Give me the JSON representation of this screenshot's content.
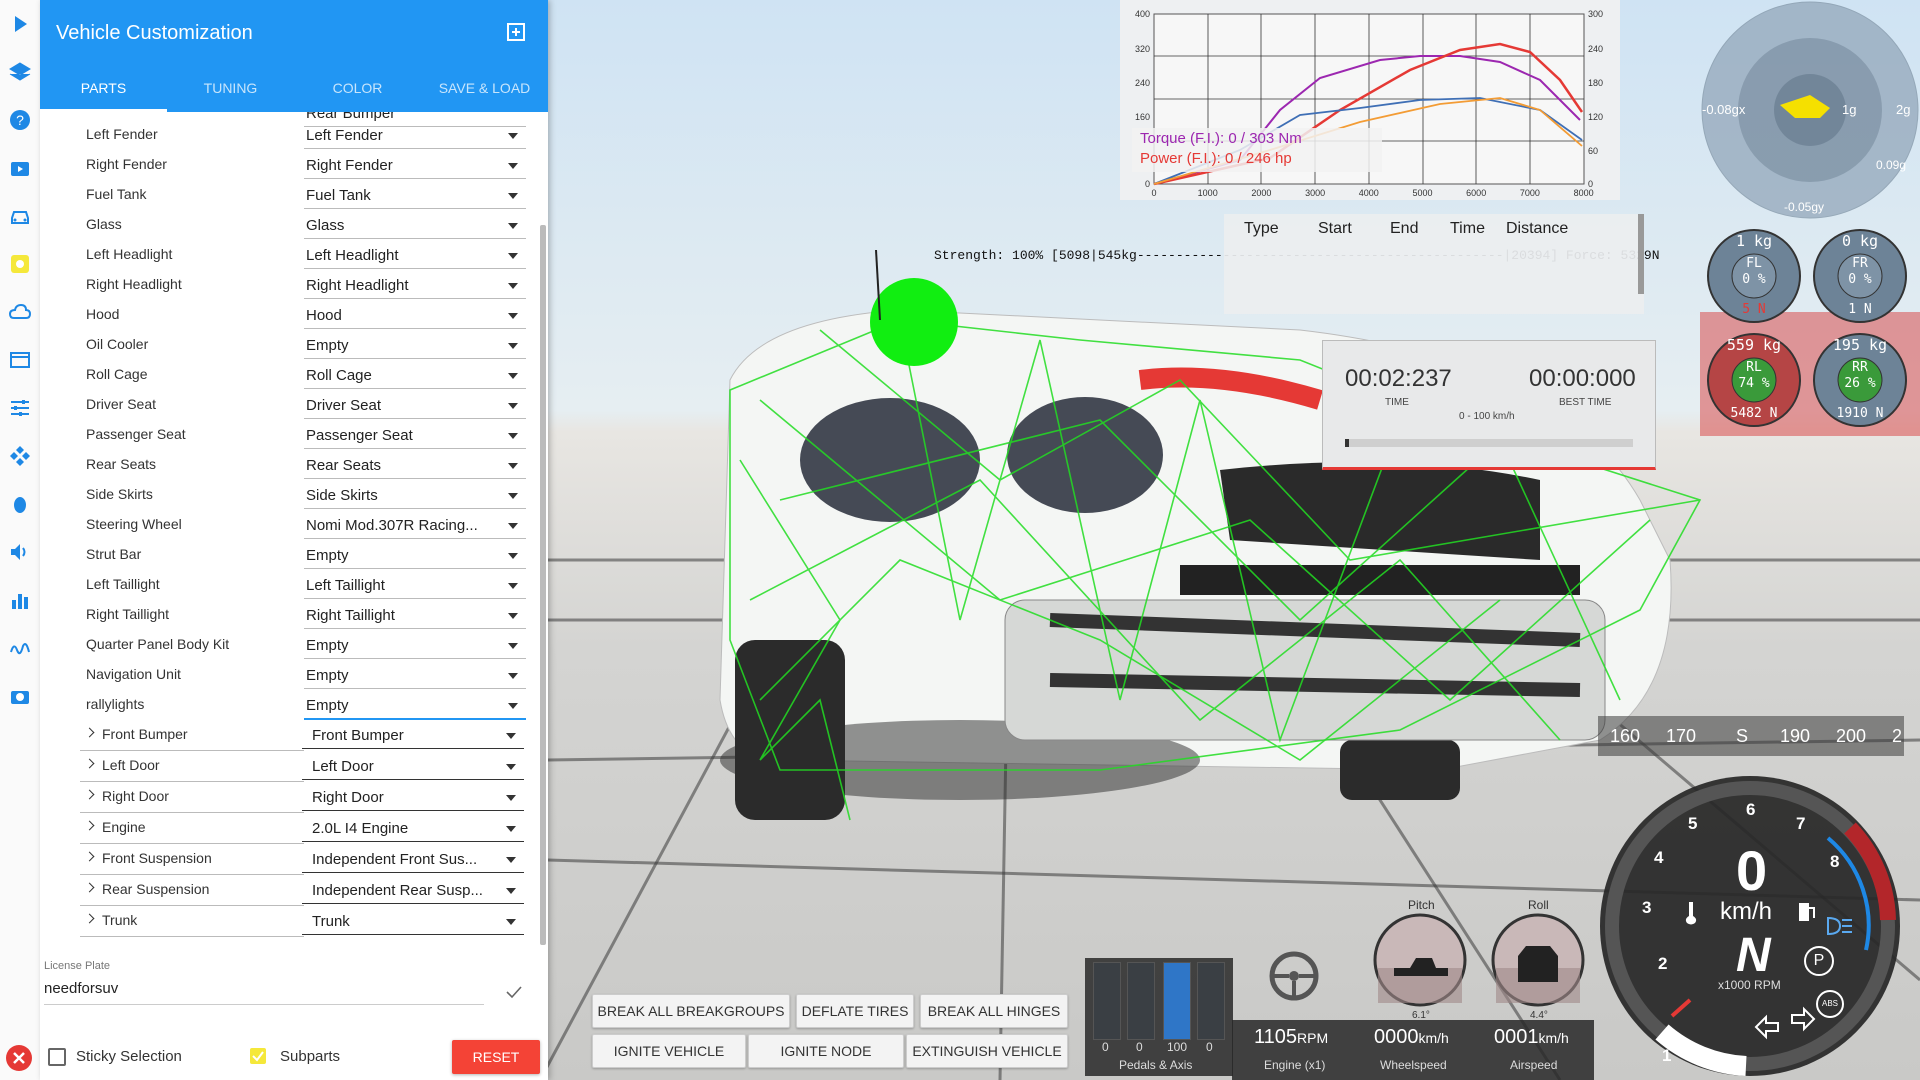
{
  "panel": {
    "title": "Vehicle Customization",
    "tabs": [
      "PARTS",
      "TUNING",
      "COLOR",
      "SAVE & LOAD"
    ],
    "active_tab": "PARTS",
    "partial_top": "Rear Bumper",
    "parts": [
      {
        "label": "Left Fender",
        "value": "Left Fender"
      },
      {
        "label": "Right Fender",
        "value": "Right Fender"
      },
      {
        "label": "Fuel Tank",
        "value": "Fuel Tank"
      },
      {
        "label": "Glass",
        "value": "Glass"
      },
      {
        "label": "Left Headlight",
        "value": "Left Headlight"
      },
      {
        "label": "Right Headlight",
        "value": "Right Headlight"
      },
      {
        "label": "Hood",
        "value": "Hood"
      },
      {
        "label": "Oil Cooler",
        "value": "Empty"
      },
      {
        "label": "Roll Cage",
        "value": "Roll Cage"
      },
      {
        "label": "Driver Seat",
        "value": "Driver Seat"
      },
      {
        "label": "Passenger Seat",
        "value": "Passenger Seat"
      },
      {
        "label": "Rear Seats",
        "value": "Rear Seats"
      },
      {
        "label": "Side Skirts",
        "value": "Side Skirts"
      },
      {
        "label": "Steering Wheel",
        "value": "Nomi Mod.307R Racing..."
      },
      {
        "label": "Strut Bar",
        "value": "Empty"
      },
      {
        "label": "Left Taillight",
        "value": "Left Taillight"
      },
      {
        "label": "Right Taillight",
        "value": "Right Taillight"
      },
      {
        "label": "Quarter Panel Body Kit",
        "value": "Empty"
      },
      {
        "label": "Navigation Unit",
        "value": "Empty"
      },
      {
        "label": "rallylights",
        "value": "Empty"
      }
    ],
    "groups": [
      {
        "label": "Front Bumper",
        "value": "Front Bumper"
      },
      {
        "label": "Left Door",
        "value": "Left Door"
      },
      {
        "label": "Right Door",
        "value": "Right Door"
      },
      {
        "label": "Engine",
        "value": "2.0L I4 Engine"
      },
      {
        "label": "Front Suspension",
        "value": "Independent Front Sus..."
      },
      {
        "label": "Rear Suspension",
        "value": "Independent Rear Susp..."
      },
      {
        "label": "Trunk",
        "value": "Trunk"
      }
    ],
    "license_plate_label": "License Plate",
    "license_plate_value": "needforsuv",
    "sticky_selection_label": "Sticky Selection",
    "subparts_label": "Subparts",
    "reset_label": "RESET"
  },
  "graph": {
    "left_ticks": [
      "400",
      "320",
      "240",
      "160",
      "0"
    ],
    "right_ticks": [
      "300",
      "240",
      "180",
      "120",
      "60",
      "0"
    ],
    "x_ticks": [
      "0",
      "1000",
      "2000",
      "3000",
      "4000",
      "5000",
      "6000",
      "7000",
      "8000"
    ],
    "torque_legend": "Torque (F.I.): 0 / 303 Nm",
    "power_legend": "Power (F.I.): 0 / 246 hp",
    "colors": {
      "torque": "#9c27b0",
      "power": "#e53935",
      "blue": "#3f6fb5",
      "orange": "#f39c35"
    }
  },
  "trip_table": {
    "headers": [
      "Type",
      "Start",
      "End",
      "Time",
      "Distance"
    ]
  },
  "strength_text": "Strength: 100% [5098|545kg-----------------------------------------------|20394] Force: 5329N",
  "timer": {
    "time": "00:02:237",
    "time_label": "TIME",
    "best": "00:00:000",
    "best_label": "BEST TIME",
    "mode": "0 - 100 km/h"
  },
  "gforce": {
    "left": "-0.08gx",
    "center": "1g",
    "right": "2g",
    "r2": "0.09g",
    "bottom": "-0.05gy"
  },
  "wheels": [
    {
      "kg": "1 kg",
      "pos": "FL",
      "pct": "0 %",
      "n": "5 N"
    },
    {
      "kg": "0 kg",
      "pos": "FR",
      "pct": "0 %",
      "n": "1 N"
    },
    {
      "kg": "559 kg",
      "pos": "RL",
      "pct": "74 %",
      "n": "5482 N"
    },
    {
      "kg": "195 kg",
      "pos": "RR",
      "pct": "26 %",
      "n": "1910 N"
    }
  ],
  "buttons": [
    "BREAK ALL BREAKGROUPS",
    "DEFLATE TIRES",
    "BREAK ALL HINGES",
    "IGNITE VEHICLE",
    "IGNITE NODE",
    "EXTINGUISH VEHICLE"
  ],
  "hud": {
    "pedals": [
      "0",
      "0",
      "100",
      "0"
    ],
    "pedals_label": "Pedals & Axis",
    "rpm": "1105",
    "rpm_unit": "RPM",
    "rpm_label": "Engine (x1)",
    "wheelspeed": "0000",
    "wheelspeed_unit": "km/h",
    "wheelspeed_label": "Wheelspeed",
    "airspeed": "0001",
    "airspeed_unit": "km/h",
    "airspeed_label": "Airspeed",
    "pitch_label": "Pitch",
    "pitch_value": "6.1°",
    "roll_label": "Roll",
    "roll_value": "4.4°"
  },
  "compass": [
    "160",
    "170",
    "S",
    "190",
    "200",
    "2"
  ],
  "speedo": {
    "speed": "0",
    "unit": "km/h",
    "gear": "N",
    "rpm_label": "x1000 RPM",
    "ticks": [
      "1",
      "2",
      "3",
      "4",
      "5",
      "6",
      "7",
      "8"
    ],
    "park": "P",
    "abs": "ABS"
  }
}
